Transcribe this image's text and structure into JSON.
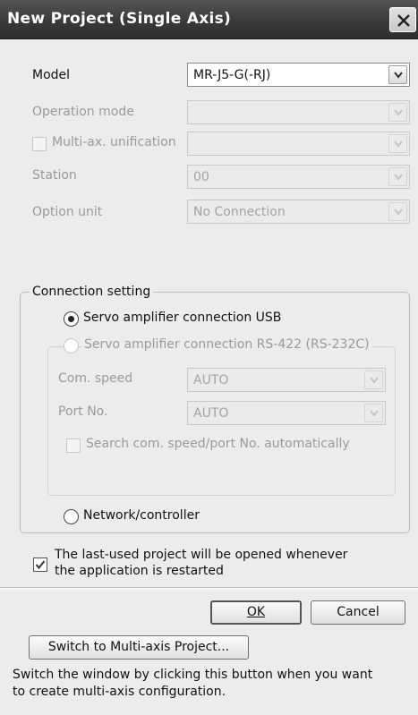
{
  "window": {
    "title": "New Project (Single Axis)"
  },
  "form": {
    "model_label": "Model",
    "model_value": "MR-J5-G(-RJ)",
    "operation_mode_label": "Operation mode",
    "operation_mode_value": "",
    "multi_axis_label": "Multi-ax. unification",
    "multi_axis_value": "",
    "station_label": "Station",
    "station_value": "00",
    "option_unit_label": "Option unit",
    "option_unit_value": "No Connection"
  },
  "connection": {
    "group_label": "Connection setting",
    "usb_label": "Servo amplifier connection USB",
    "rs422_label": "Servo amplifier connection RS-422 (RS-232C)",
    "com_speed_label": "Com. speed",
    "com_speed_value": "AUTO",
    "port_label": "Port No.",
    "port_value": "AUTO",
    "search_label": "Search com. speed/port No. automatically",
    "network_label": "Network/controller",
    "selected": "usb"
  },
  "restart_option": {
    "line1": "The last-used project will be opened whenever",
    "line2": "the application is restarted",
    "checked": true
  },
  "buttons": {
    "ok": "OK",
    "cancel": "Cancel",
    "switch": "Switch to Multi-axis Project..."
  },
  "description": {
    "line1": "Switch the window by clicking this button when you want",
    "line2": "to create multi-axis configuration."
  }
}
